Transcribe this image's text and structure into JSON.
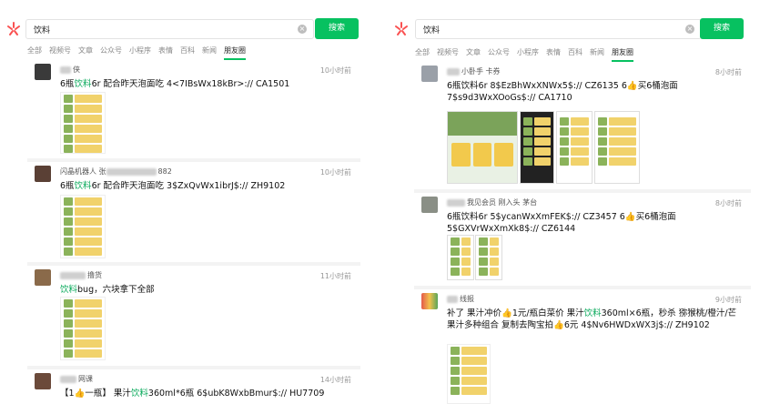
{
  "left_panel": {
    "search": {
      "query": "饮料",
      "button": "搜索",
      "clear": "×"
    },
    "tabs": [
      {
        "label": "全部",
        "active": false
      },
      {
        "label": "视频号",
        "active": false
      },
      {
        "label": "文章",
        "active": false
      },
      {
        "label": "公众号",
        "active": false
      },
      {
        "label": "小程序",
        "active": false
      },
      {
        "label": "表情",
        "active": false
      },
      {
        "label": "百科",
        "active": false
      },
      {
        "label": "新闻",
        "active": false
      },
      {
        "label": "朋友圈",
        "active": true
      }
    ],
    "posts": [
      {
        "name": "侠",
        "time": "10小时前",
        "pre": "6瓶",
        "hl": "饮料",
        "post": "6r 配合昨天泡面吃 4<7IBsWx18kBr>:// CA1501"
      },
      {
        "name": "闪晶机器人 张",
        "name_tail": "882",
        "time": "10小时前",
        "pre": "6瓶",
        "hl": "饮料",
        "post": "6r 配合昨天泡面吃 3$ZxQvWx1ibrJ$:// ZH9102"
      },
      {
        "name": "撸货",
        "time": "11小时前",
        "pre": "",
        "hl": "饮料",
        "post": "bug，六块拿下全部"
      },
      {
        "name": "网课",
        "time": "14小时前",
        "pre": "【1👍一瓶】 果汁",
        "hl": "饮料",
        "post": "360ml*6瓶 6$ubK8WxbBmur$:// HU7709"
      }
    ]
  },
  "right_panel": {
    "search": {
      "query": "饮料",
      "button": "搜索",
      "clear": "×"
    },
    "tabs": [
      {
        "label": "全部",
        "active": false
      },
      {
        "label": "视频号",
        "active": false
      },
      {
        "label": "文章",
        "active": false
      },
      {
        "label": "公众号",
        "active": false
      },
      {
        "label": "小程序",
        "active": false
      },
      {
        "label": "表情",
        "active": false
      },
      {
        "label": "百科",
        "active": false
      },
      {
        "label": "新闻",
        "active": false
      },
      {
        "label": "朋友圈",
        "active": true
      }
    ],
    "posts": [
      {
        "name": "小卧手 卡券",
        "time": "8小时前",
        "text": "6瓶饮料6r 8$EzBhWxXNWx5$:// CZ6135 6👍买6桶泡面 7$s9d3WxXOoGs$:// CA1710"
      },
      {
        "name": "我见会员 刚入头 茅台",
        "time": "8小时前",
        "text": "6瓶饮料6r 5$ycanWxXmFEK$:// CZ3457 6👍买6桶泡面 5$GXVrWxXmXk8$:// CZ6144"
      },
      {
        "name": "线报",
        "time": "9小时前",
        "pre": "补了 果汁冲价👍1元/瓶白菜价 果汁",
        "hl": "饮料",
        "post": "360ml×6瓶，秒杀 猕猴桃/橙汁/芒果汁多种组合 复制去陶宝拍👍6元 4$Nv6HWDxWX3j$:// ZH9102"
      }
    ]
  },
  "colors": {
    "accent": "#07c160",
    "highlight": "#07a95a",
    "logo": "#fa5151"
  }
}
